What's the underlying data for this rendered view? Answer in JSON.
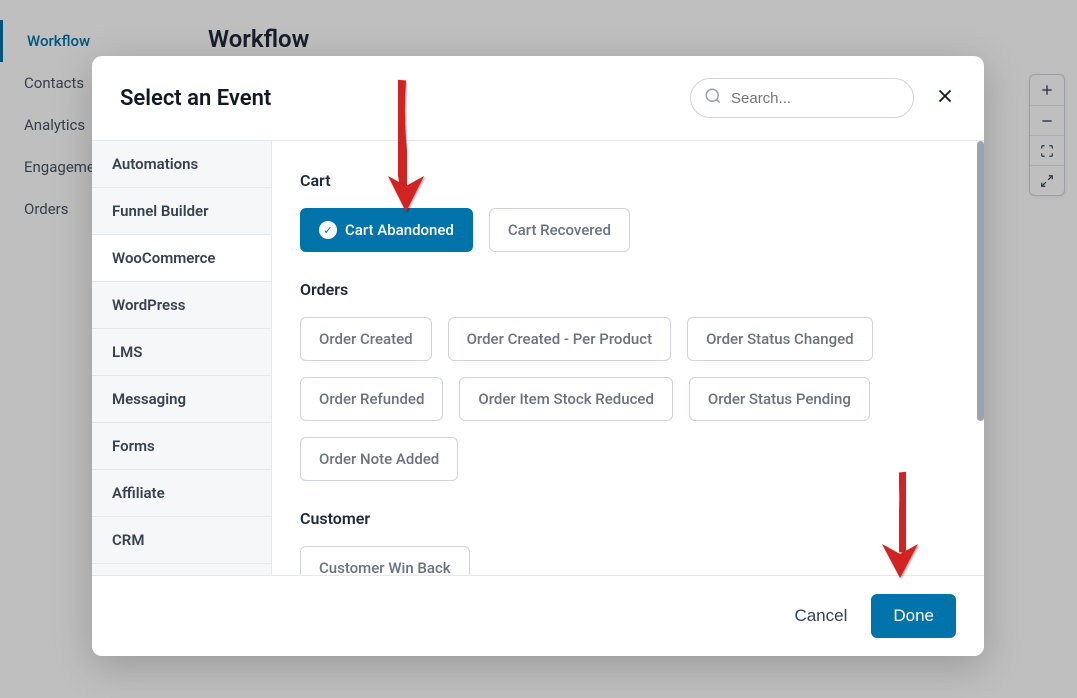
{
  "page": {
    "title": "Workflow"
  },
  "sidebar": {
    "items": [
      {
        "label": "Workflow",
        "active": true
      },
      {
        "label": "Contacts",
        "active": false
      },
      {
        "label": "Analytics",
        "active": false
      },
      {
        "label": "Engagement",
        "active": false
      },
      {
        "label": "Orders",
        "active": false
      }
    ]
  },
  "modal": {
    "title": "Select an Event",
    "search_placeholder": "Search...",
    "categories": [
      {
        "label": "Automations"
      },
      {
        "label": "Funnel Builder"
      },
      {
        "label": "WooCommerce"
      },
      {
        "label": "WordPress"
      },
      {
        "label": "LMS"
      },
      {
        "label": "Messaging"
      },
      {
        "label": "Forms"
      },
      {
        "label": "Affiliate"
      },
      {
        "label": "CRM"
      }
    ],
    "sections": [
      {
        "label": "Cart",
        "events": [
          {
            "label": "Cart Abandoned",
            "selected": true
          },
          {
            "label": "Cart Recovered",
            "selected": false
          }
        ]
      },
      {
        "label": "Orders",
        "events": [
          {
            "label": "Order Created",
            "selected": false
          },
          {
            "label": "Order Created - Per Product",
            "selected": false
          },
          {
            "label": "Order Status Changed",
            "selected": false
          },
          {
            "label": "Order Refunded",
            "selected": false
          },
          {
            "label": "Order Item Stock Reduced",
            "selected": false
          },
          {
            "label": "Order Status Pending",
            "selected": false
          },
          {
            "label": "Order Note Added",
            "selected": false
          }
        ]
      },
      {
        "label": "Customer",
        "events": [
          {
            "label": "Customer Win Back",
            "selected": false
          }
        ]
      }
    ],
    "footer": {
      "cancel": "Cancel",
      "done": "Done"
    }
  }
}
